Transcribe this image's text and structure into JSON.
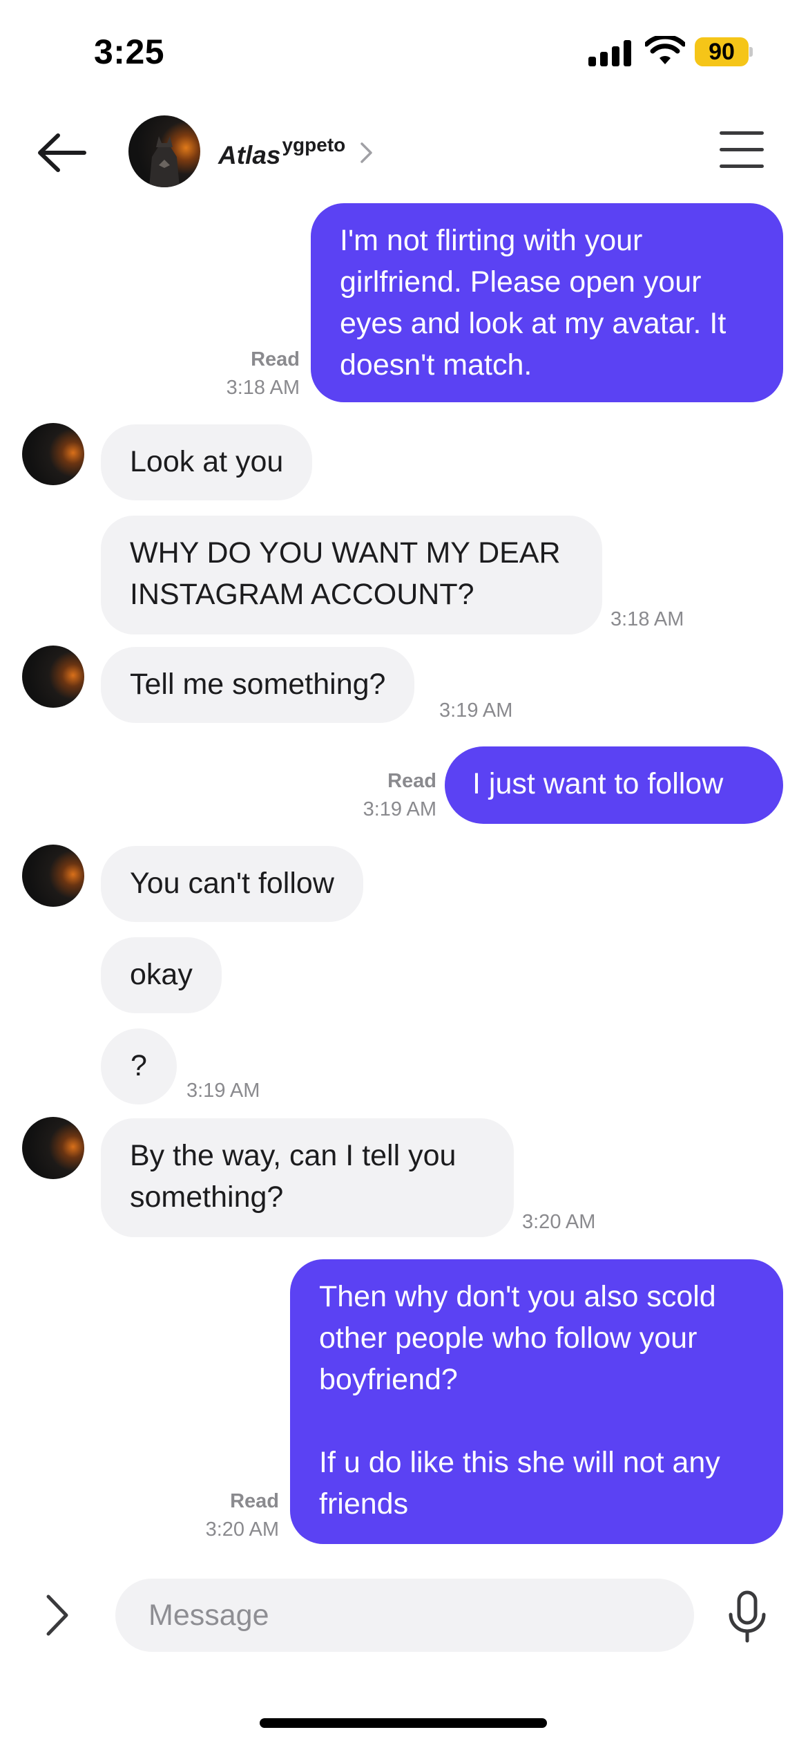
{
  "status_bar": {
    "time": "3:25",
    "battery": "90",
    "battery_color": "#f5c518",
    "icons": [
      "signal-icon",
      "wifi-icon",
      "battery-icon"
    ]
  },
  "header": {
    "name": "Atlas",
    "name_suffix": "ygpeto",
    "icons": [
      "back-arrow-icon",
      "chevron-right-icon",
      "menu-icon"
    ]
  },
  "colors": {
    "outgoing_bubble": "#5b42f3",
    "incoming_bubble": "#f2f2f4"
  },
  "messages": [
    {
      "direction": "outgoing",
      "text": "I'm not flirting with your\ngirlfriend. Please open your\neyes and look at my avatar. It\ndoesn't match.",
      "status": "Read",
      "time": "3:18 AM"
    },
    {
      "direction": "incoming",
      "text": "Look at you"
    },
    {
      "direction": "incoming",
      "text": "WHY DO YOU WANT MY DEAR\nINSTAGRAM ACCOUNT?",
      "time": "3:18 AM"
    },
    {
      "direction": "incoming",
      "text": "Tell me something?",
      "time": "3:19 AM"
    },
    {
      "direction": "outgoing",
      "text": "I just want to follow",
      "status": "Read",
      "time": "3:19 AM"
    },
    {
      "direction": "incoming",
      "text": "You can't follow"
    },
    {
      "direction": "incoming",
      "text": "okay"
    },
    {
      "direction": "incoming",
      "text": "?",
      "time": "3:19 AM"
    },
    {
      "direction": "incoming",
      "text": "By the way, can I tell you\nsomething?",
      "time": "3:20 AM"
    },
    {
      "direction": "outgoing",
      "text": "Then why don't you also scold\nother people who follow your\nboyfriend?\n\nIf u do like this she will not any\nfriends",
      "status": "Read",
      "time": "3:20 AM"
    }
  ],
  "composer": {
    "placeholder": "Message",
    "icons": [
      "chevron-right-icon",
      "microphone-icon"
    ]
  }
}
